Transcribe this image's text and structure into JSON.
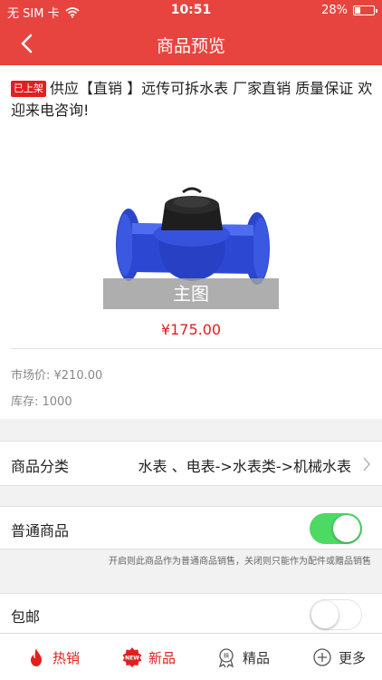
{
  "status_bar": {
    "carrier": "无 SIM 卡",
    "time": "10:51",
    "battery_text": "28%",
    "battery_level": 0.28
  },
  "header": {
    "title": "商品预览",
    "back_icon": "chevron-left-icon"
  },
  "product": {
    "status_badge": "已上架",
    "title": "供应【直销 】远传可拆水表 厂家直销 质量保证 欢迎来电咨询!",
    "image_label": "主图",
    "price": "¥175.00",
    "market_price": "市场价:  ¥210.00",
    "stock": "库存:  1000"
  },
  "category": {
    "label": "商品分类",
    "value": "水表 、电表->水表类->机械水表"
  },
  "normal_item": {
    "label": "普通商品",
    "toggle_on": true,
    "hint": "开启则此商品作为普通商品销售，关闭则只能作为配件或赠品销售"
  },
  "free_shipping": {
    "label": "包邮",
    "toggle_on": false
  },
  "tabs": [
    {
      "label": "热销",
      "icon": "flame-icon"
    },
    {
      "label": "新品",
      "icon": "new-badge-icon"
    },
    {
      "label": "精品",
      "icon": "ribbon-icon"
    },
    {
      "label": "更多",
      "icon": "plus-circle-icon"
    }
  ],
  "colors": {
    "brand": "#e8443f",
    "price": "#e02020",
    "toggle_on": "#4cd964"
  }
}
